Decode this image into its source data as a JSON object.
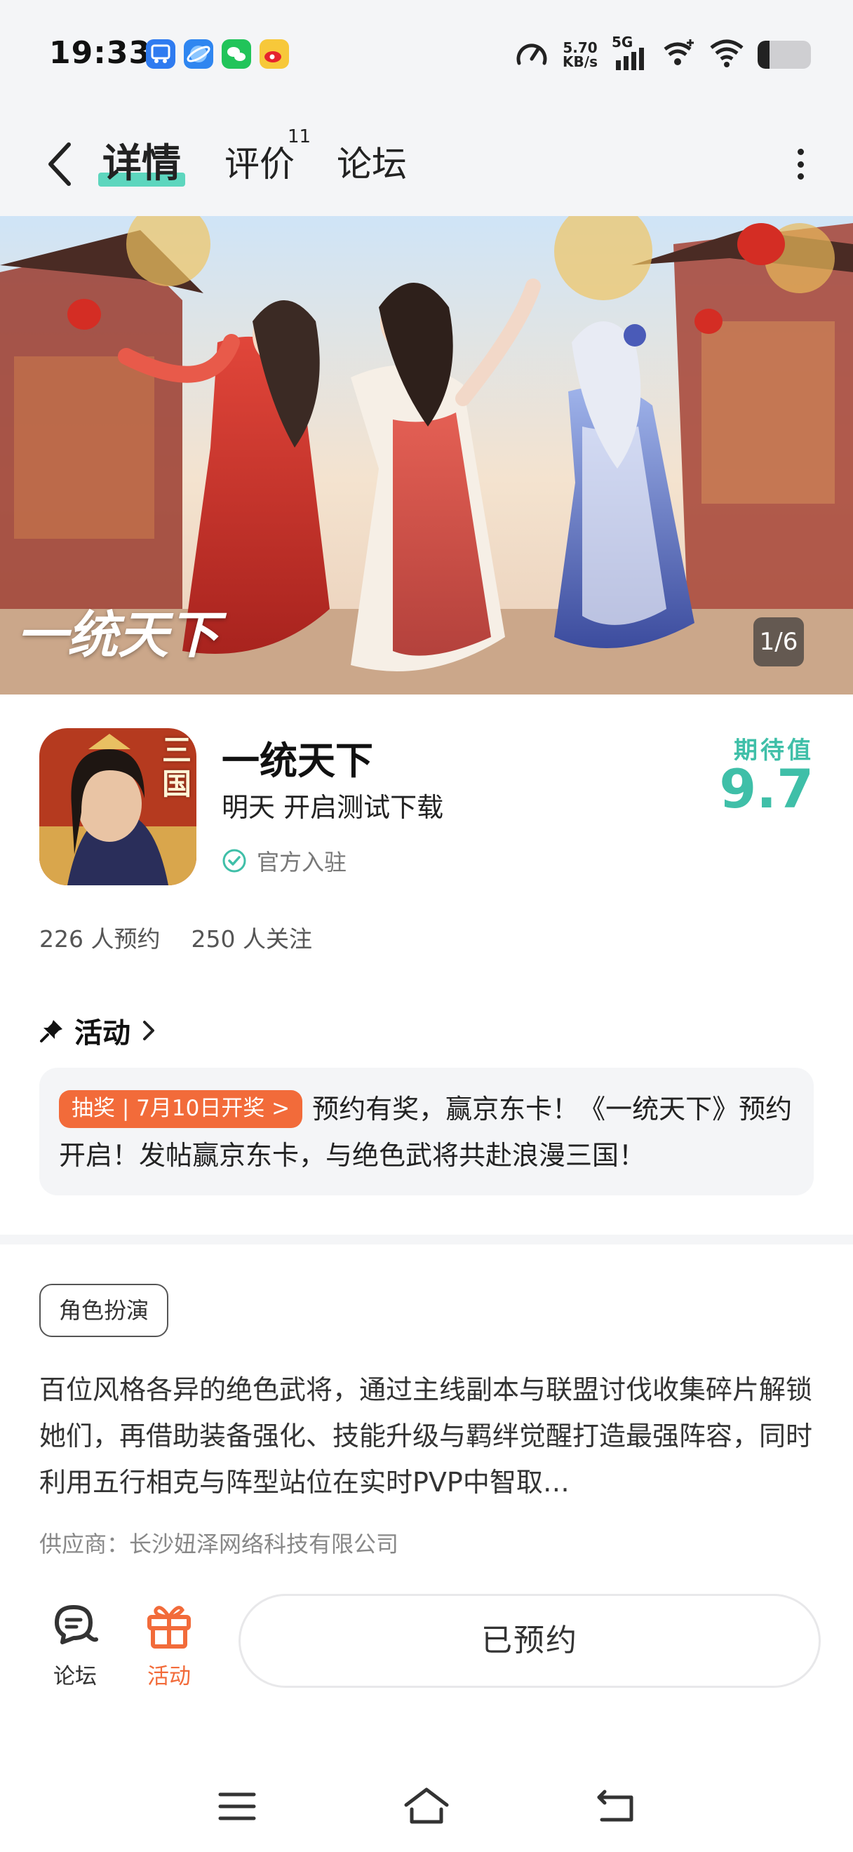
{
  "status_bar": {
    "time": "19:33",
    "net_speed_value": "5.70",
    "net_speed_unit": "KB/s",
    "network_type": "5G",
    "app_icons": [
      "scissors-app-icon",
      "browser-app-icon",
      "wechat-icon",
      "weibo-icon"
    ],
    "battery_level": 0.22
  },
  "nav": {
    "tabs": [
      {
        "label": "详情",
        "active": true
      },
      {
        "label": "评价",
        "badge": "11"
      },
      {
        "label": "论坛"
      }
    ]
  },
  "banner": {
    "overlay_title": "一统天下",
    "counter": "1/6"
  },
  "app": {
    "name": "一统天下",
    "status": "明天 开启测试下载",
    "verified_label": "官方入驻",
    "icon_text": "三国",
    "score_label": "期待值",
    "score": "9.7",
    "reservations": "226 人预约",
    "followers": "250 人关注"
  },
  "activity": {
    "header": "活动",
    "tag": "抽奖 | 7月10日开奖 >",
    "text": "预约有奖，赢京东卡！《一统天下》预约开启！发帖赢京东卡，与绝色武将共赴浪漫三国！"
  },
  "detail": {
    "genre": "角色扮演",
    "description": "百位风格各异的绝色武将，通过主线副本与联盟讨伐收集碎片解锁她们，再借助装备强化、技能升级与羁绊觉醒打造最强阵容，同时利用五行相克与阵型站位在实时PVP中智取…",
    "supplier": "供应商：长沙妞泽网络科技有限公司"
  },
  "bottom_bar": {
    "forum_label": "论坛",
    "activity_label": "活动",
    "reserve_button": "已预约"
  },
  "colors": {
    "accent_teal": "#3fbfa8",
    "accent_orange": "#f26b3a",
    "page_bg": "#f4f5f7"
  }
}
